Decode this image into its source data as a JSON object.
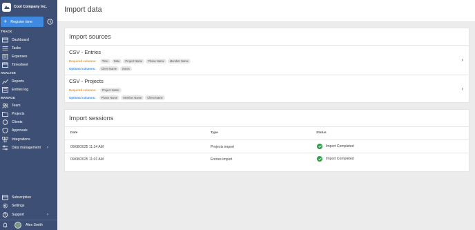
{
  "brand": {
    "name": "Cool Company Inc."
  },
  "register": {
    "label": "Register time"
  },
  "sections": {
    "track": "TRACK",
    "analyze": "ANALYZE",
    "manage": "MANAGE"
  },
  "nav": {
    "dashboard": "Dashboard",
    "tasks": "Tasks",
    "expenses": "Expenses",
    "timesheet": "Timesheet",
    "reports": "Reports",
    "entries_log": "Entries log",
    "team": "Team",
    "projects": "Projects",
    "clients": "Clients",
    "approvals": "Approvals",
    "integrations": "Integrations",
    "data_management": "Data management",
    "subscription": "Subscription",
    "settings": "Settings",
    "support": "Support"
  },
  "user": {
    "name": "Alex Smith"
  },
  "page": {
    "title": "Import data"
  },
  "import_sources": {
    "title": "Import sources",
    "required_label": "Required columns:",
    "optional_label": "Optional columns:",
    "sources": [
      {
        "title": "CSV - Entries",
        "required": [
          "Time",
          "Date",
          "Project Name",
          "Phase Name",
          "Member Name"
        ],
        "optional": [
          "Client Name",
          "Notes"
        ]
      },
      {
        "title": "CSV - Projects",
        "required": [
          "Project Name"
        ],
        "optional": [
          "Phase Name",
          "Member Name",
          "Client Name"
        ]
      }
    ]
  },
  "import_sessions": {
    "title": "Import sessions",
    "columns": {
      "date": "Date",
      "type": "Type",
      "status": "Status"
    },
    "rows": [
      {
        "date": "09/08/2025 11:34 AM",
        "type": "Projects import",
        "status": "Import Completed"
      },
      {
        "date": "09/08/2025 11:01 AM",
        "type": "Entries import",
        "status": "Import Completed"
      }
    ]
  },
  "colors": {
    "sidebar": "#3d4f74",
    "accent": "#3d8ae0",
    "required": "#e09a2c",
    "success": "#2e9e4a"
  }
}
